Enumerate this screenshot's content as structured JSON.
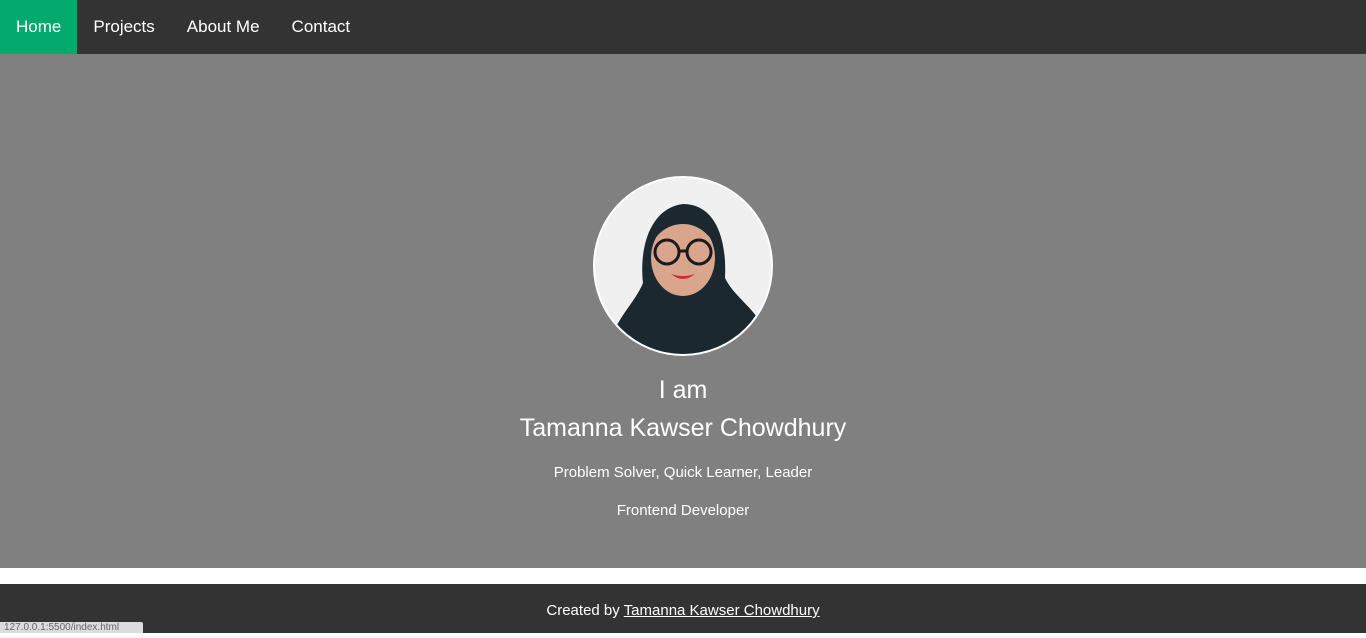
{
  "nav": {
    "items": [
      {
        "label": "Home",
        "active": true
      },
      {
        "label": "Projects",
        "active": false
      },
      {
        "label": "About Me",
        "active": false
      },
      {
        "label": "Contact",
        "active": false
      }
    ]
  },
  "hero": {
    "line1": "I am",
    "name": "Tamanna Kawser Chowdhury",
    "traits": "Problem Solver, Quick Learner, Leader",
    "role": "Frontend Developer"
  },
  "footer": {
    "prefix": "Created by ",
    "link": "Tamanna Kawser Chowdhury"
  },
  "status_bar": {
    "url": "127.0.0.1:5500/index.html"
  },
  "colors": {
    "nav_bg": "#333333",
    "active": "#04aa6d",
    "hero_bg": "#808080"
  }
}
